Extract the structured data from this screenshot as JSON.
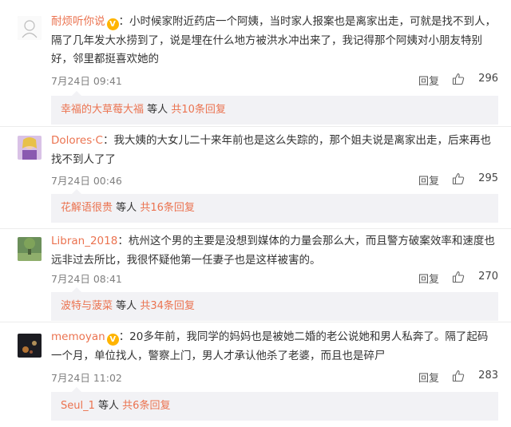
{
  "comments": [
    {
      "username": "耐烦听你说",
      "badge": "V",
      "text": "：小时候家附近药店一个阿姨，当时家人报案也是离家出走，可就是找不到人，隔了几年发大水捞到了，说是埋在什么地方被洪水冲出来了，我记得那个阿姨对小朋友特别好，邻里都挺喜欢她的",
      "time": "7月24日 09:41",
      "reply_label": "回复",
      "likes": "296",
      "thread": {
        "user": "幸福的大草莓大福",
        "others": "等人",
        "count": "共10条回复"
      }
    },
    {
      "username": "Dolores·C",
      "text": "：我大姨的大女儿二十来年前也是这么失踪的，那个姐夫说是离家出走，后来再也找不到人了了",
      "time": "7月24日 00:46",
      "reply_label": "回复",
      "likes": "295",
      "thread": {
        "user": "花解语很贵",
        "others": "等人",
        "count": "共16条回复"
      }
    },
    {
      "username": "Libran_2018",
      "text": "：杭州这个男的主要是没想到媒体的力量会那么大，而且警方破案效率和速度也远非过去所比，我很怀疑他第一任妻子也是这样被害的。",
      "time": "7月24日 08:41",
      "reply_label": "回复",
      "likes": "270",
      "thread": {
        "user": "波特与菠菜",
        "others": "等人",
        "count": "共34条回复"
      }
    },
    {
      "username": "memoyan",
      "badge": "V",
      "text": "：20多年前，我同学的妈妈也是被她二婚的老公说她和男人私奔了。隔了起码一个月，单位找人，警察上门，男人才承认他杀了老婆，而且也是碎尸",
      "time": "7月24日 11:02",
      "reply_label": "回复",
      "likes": "283",
      "thread": {
        "user": "Seul_1",
        "others": "等人",
        "count": "共6条回复"
      }
    }
  ],
  "icons": {
    "like": "thumbs-up-icon",
    "badge": "v-badge-icon"
  },
  "colors": {
    "username": "#eb7350",
    "subbox": "#f2f2f5",
    "meta": "#808080"
  }
}
